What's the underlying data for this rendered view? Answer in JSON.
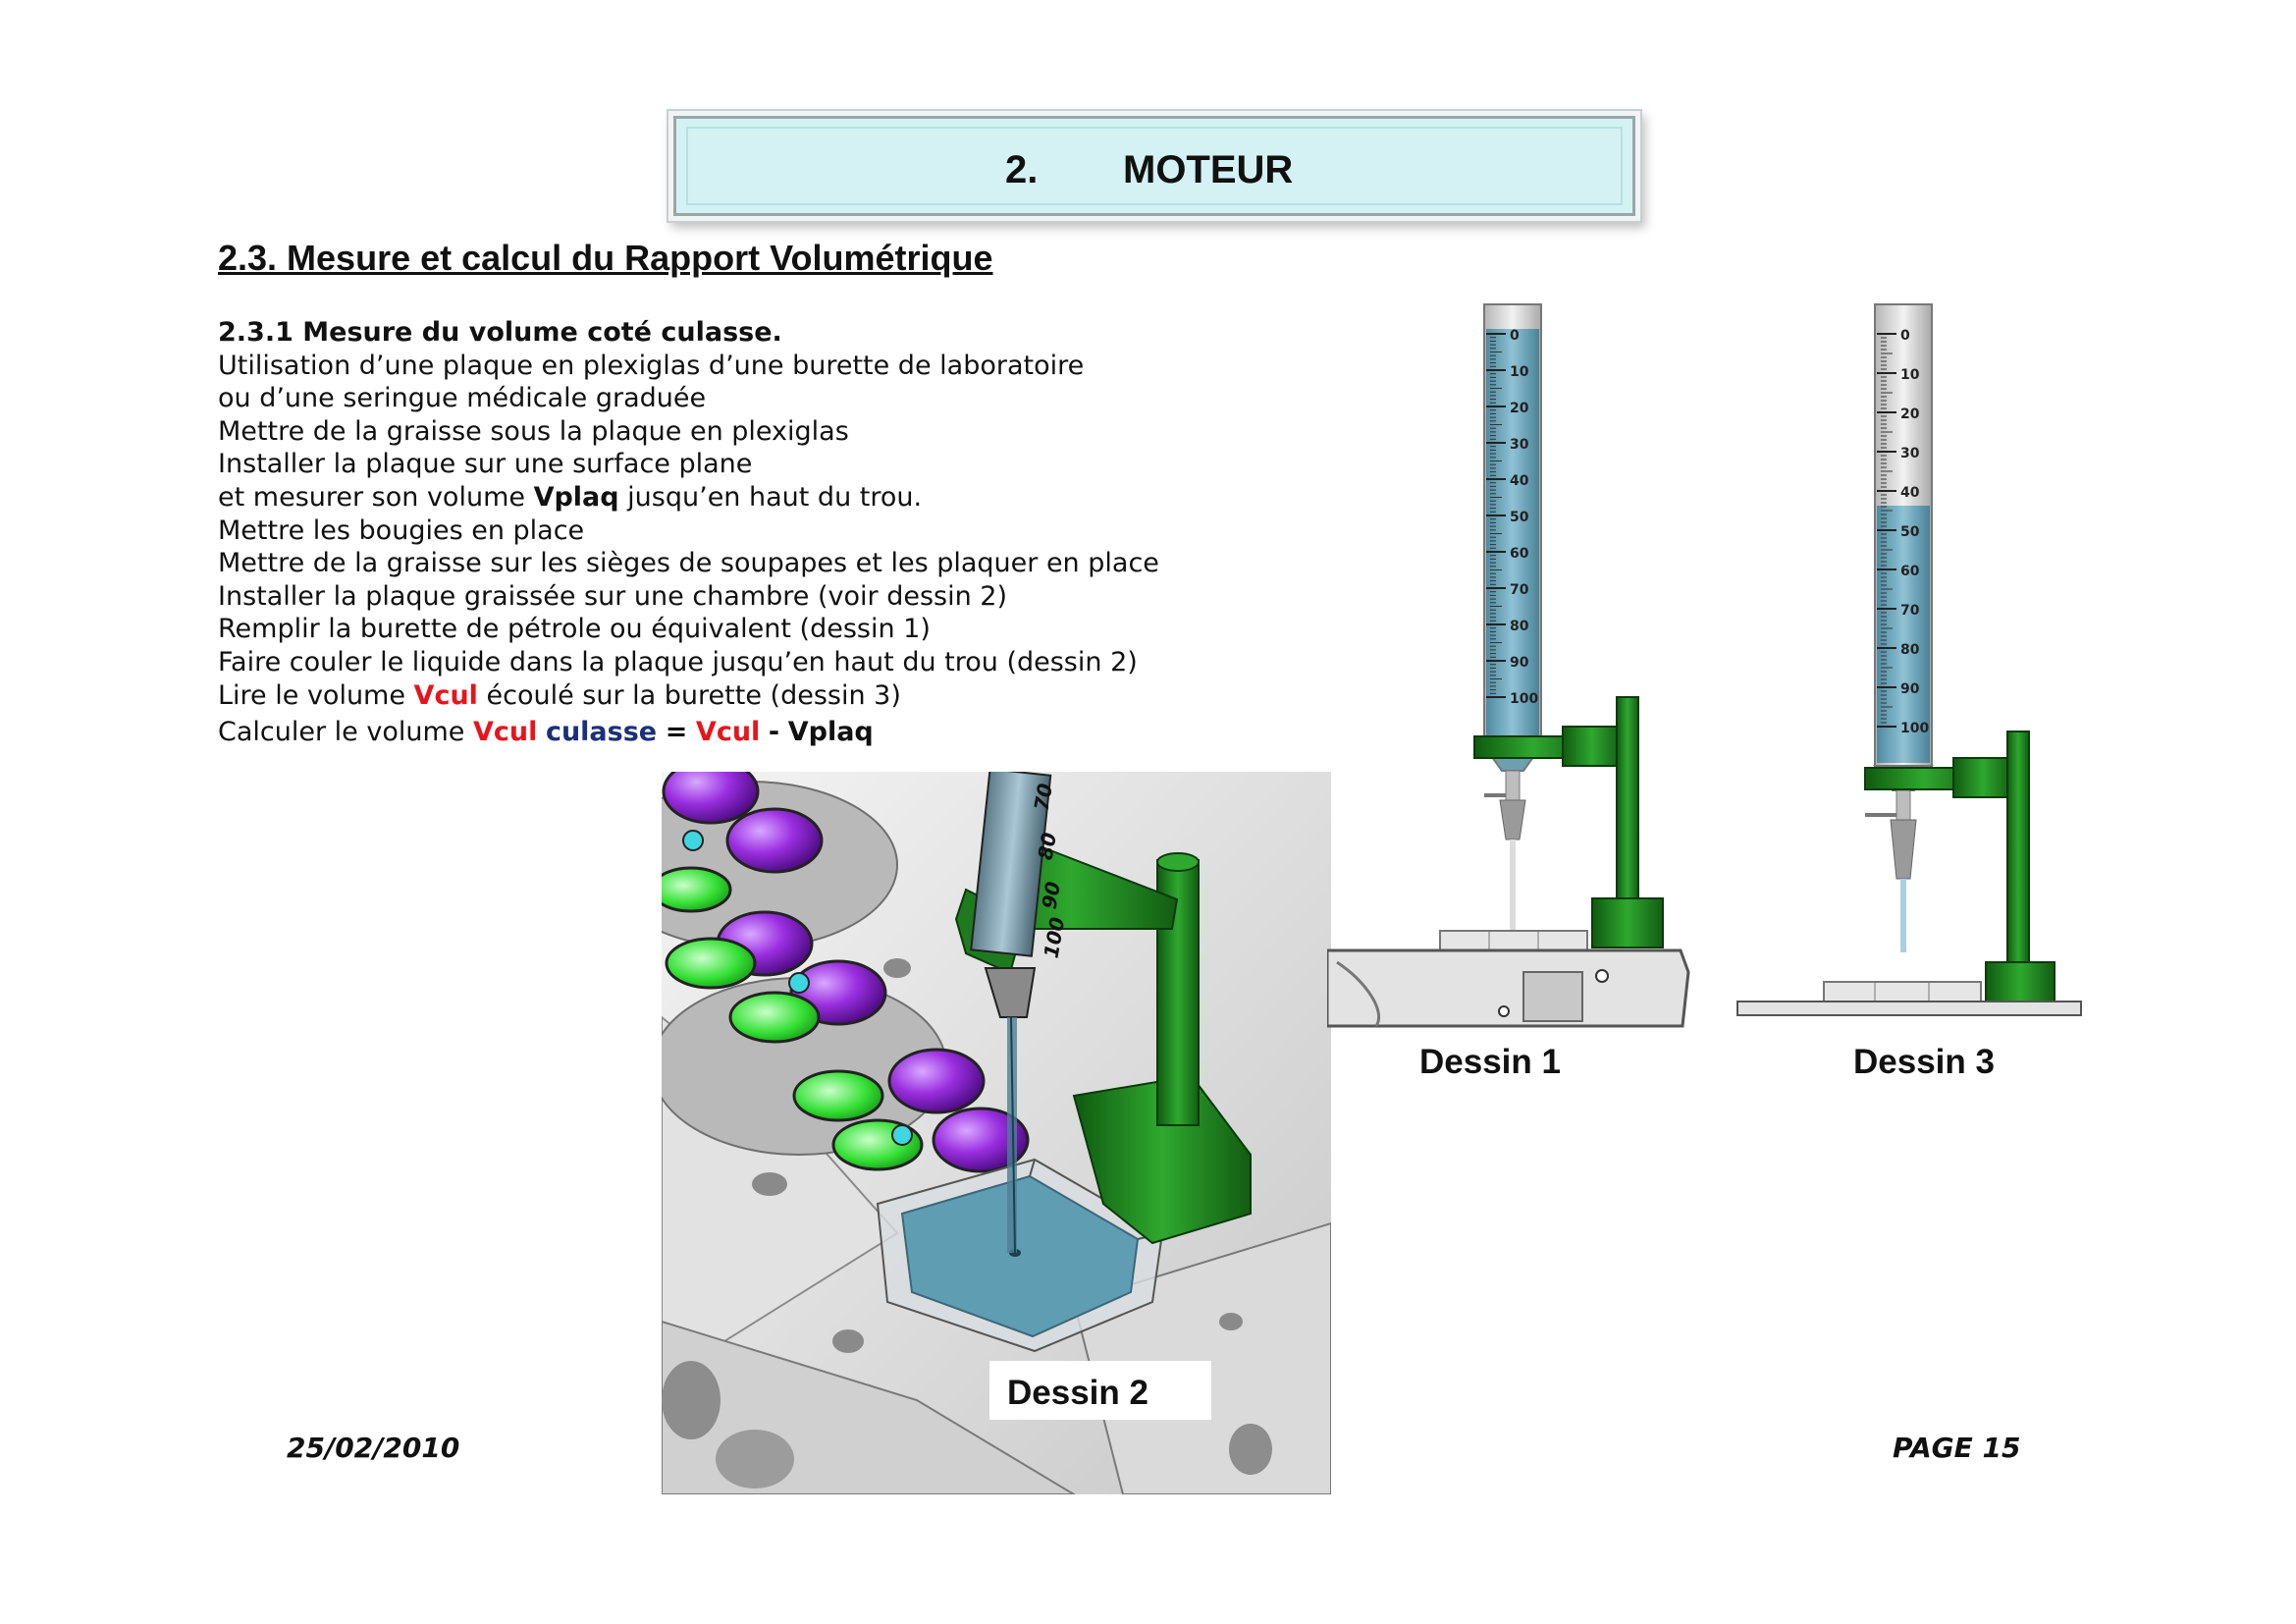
{
  "header": {
    "number": "2.",
    "title": "MOTEUR"
  },
  "section": {
    "title": "2.3. Mesure et calcul du Rapport Volumétrique"
  },
  "subsection": {
    "title": "2.3.1 Mesure du volume coté culasse."
  },
  "body": {
    "l1": "Utilisation d’une plaque en plexiglas d’une burette de laboratoire",
    "l2": "ou d’une seringue médicale graduée",
    "l3": "Mettre de la graisse sous la plaque en plexiglas",
    "l4": "Installer la plaque sur une surface plane",
    "l5a": "et mesurer son volume ",
    "l5b": "Vplaq",
    "l5c": " jusqu’en haut du trou.",
    "l6": "Mettre les bougies en place",
    "l7": "Mettre de la graisse sur les sièges de soupapes et les plaquer en place",
    "l8": "Installer la plaque graissée sur une chambre (voir dessin 2)",
    "l9": "Remplir la burette de pétrole ou équivalent (dessin 1)",
    "l10": "Faire couler le liquide dans la plaque jusqu’en haut du trou (dessin 2)",
    "l11a": "Lire le volume ",
    "l11b": "Vcul",
    "l11c": " écoulé sur la burette (dessin 3)",
    "l12a": "Calculer le volume ",
    "l12b": "Vcul",
    "l12c": "culasse",
    "l12d": "=",
    "l12e": "Vcul",
    "l12f": "-",
    "l12g": "Vplaq"
  },
  "figures": {
    "dessin1": {
      "caption": "Dessin 1"
    },
    "dessin2": {
      "caption": "Dessin 2",
      "syringe_labels": [
        "70",
        "80",
        "90",
        "100"
      ]
    },
    "dessin3": {
      "caption": "Dessin 3"
    },
    "burette_scale": [
      "0",
      "10",
      "20",
      "30",
      "40",
      "50",
      "60",
      "70",
      "80",
      "90",
      "100"
    ],
    "colors": {
      "liquid": "#6aa7be",
      "stand": "#1f7a1f",
      "valve_purple": "#9a2fe0",
      "valve_green": "#35e035"
    }
  },
  "footer": {
    "date": "25/02/2010",
    "page": "PAGE 15"
  }
}
